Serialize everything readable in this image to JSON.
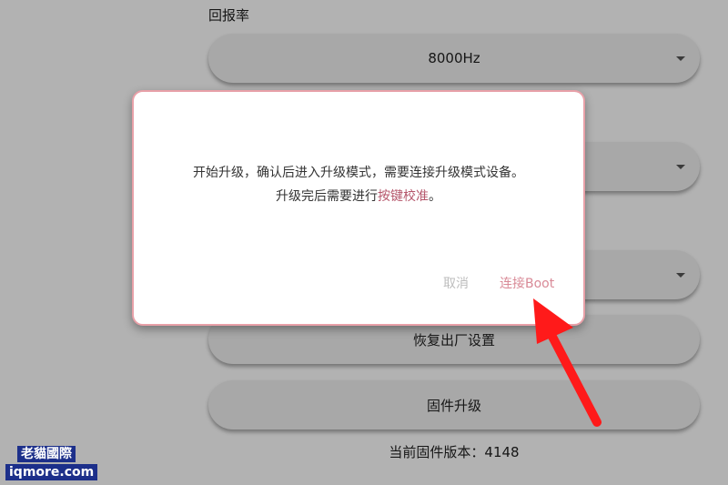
{
  "background": {
    "section_label": "回报率",
    "polling_rate_value": "8000Hz",
    "factory_reset_button": "恢复出厂设置",
    "firmware_upgrade_button": "固件升级",
    "firmware_version_text": "当前固件版本：4148"
  },
  "dialog": {
    "message_line1": "开始升级，确认后进入升级模式，需要连接升级模式设备。",
    "message_line2_prefix": "升级完后需要进行",
    "message_line2_link": "按键校准",
    "message_line2_suffix": "。",
    "cancel_label": "取消",
    "confirm_label": "连接Boot"
  },
  "watermark": {
    "line1": "老貓國際",
    "line2": "iqmore.com"
  },
  "colors": {
    "accent": "#b5566b",
    "dialog_border": "#e8a0a8",
    "arrow": "#ff1a1a"
  }
}
